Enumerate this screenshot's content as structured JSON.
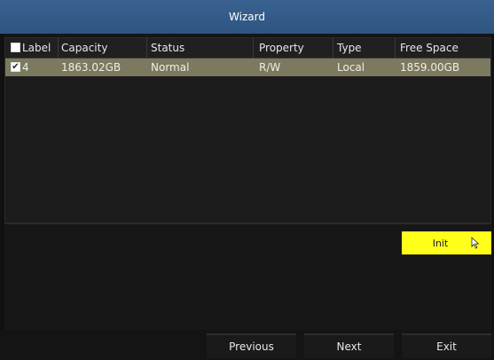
{
  "window": {
    "title": "Wizard"
  },
  "table": {
    "headers": {
      "label": "Label",
      "capacity": "Capacity",
      "status": "Status",
      "property": "Property",
      "type": "Type",
      "free_space": "Free Space"
    },
    "rows": [
      {
        "checked": true,
        "label": "4",
        "capacity": "1863.02GB",
        "status": "Normal",
        "property": "R/W",
        "type": "Local",
        "free_space": "1859.00GB"
      }
    ]
  },
  "buttons": {
    "init": "Init",
    "previous": "Previous",
    "next": "Next",
    "exit": "Exit"
  },
  "colors": {
    "title_bar": "#2e5581",
    "selected_row": "#7c7a5e",
    "init_button": "#ffff1a"
  },
  "icons": {
    "checkbox_check": "✔"
  }
}
